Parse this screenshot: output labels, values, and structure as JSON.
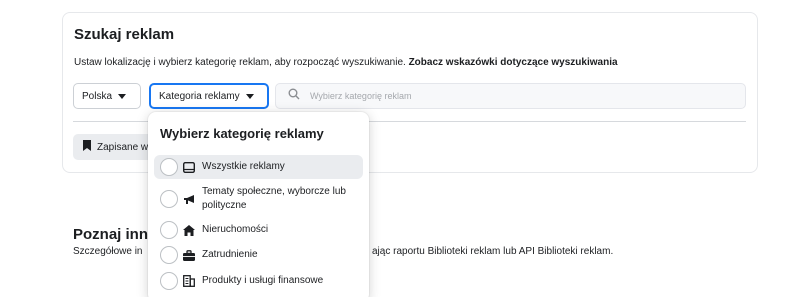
{
  "search_card": {
    "title": "Szukaj reklam",
    "description": "Ustaw lokalizację i wybierz kategorię reklam, aby rozpocząć wyszukiwanie.",
    "description_link": "Zobacz wskazówki dotyczące wyszukiwania",
    "country_value": "Polska",
    "category_value": "Kategoria reklamy",
    "search_placeholder": "Wybierz kategorię reklam",
    "saved_label": "Zapisane w"
  },
  "section": {
    "title": "Poznaj inne",
    "description_start": "Szczegółowe in",
    "description_end": "ając raportu Biblioteki reklam lub API Biblioteki reklam."
  },
  "dropdown": {
    "title": "Wybierz kategorię reklamy",
    "items": [
      {
        "label": "Wszystkie reklamy",
        "icon": "tablet-icon",
        "selected": true
      },
      {
        "label_line1": "Tematy społeczne, wyborcze lub",
        "label_line2": "polityczne",
        "icon": "megaphone-icon",
        "selected": false
      },
      {
        "label": "Nieruchomości",
        "icon": "house-icon",
        "selected": false
      },
      {
        "label": "Zatrudnienie",
        "icon": "briefcase-icon",
        "selected": false
      },
      {
        "label": "Produkty i usługi finansowe",
        "icon": "bank-icon",
        "selected": false
      }
    ]
  },
  "colors": {
    "accent": "#1877f2",
    "text": "#1c1e21",
    "selected_bg": "#eaecef"
  }
}
